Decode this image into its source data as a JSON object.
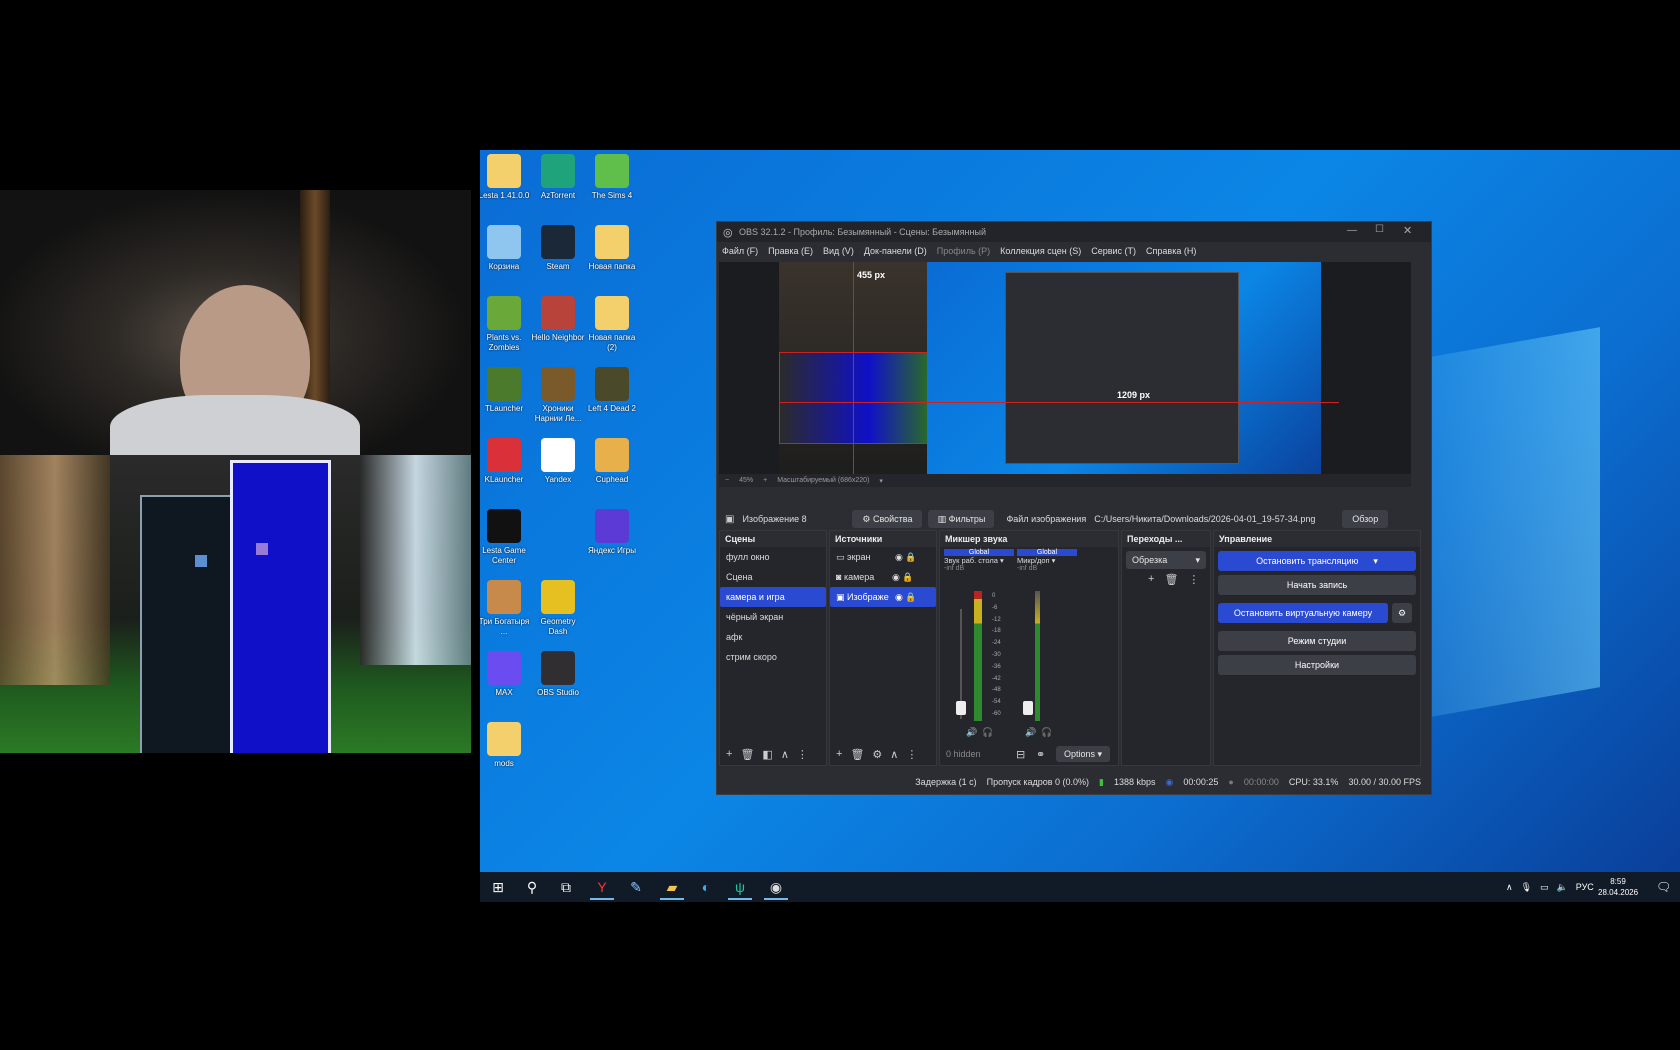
{
  "desktop_icons": [
    {
      "label": "Lesta 1.41.0.0",
      "icon": "folder-icon",
      "color": "#f3d06b"
    },
    {
      "label": "AzTorrent",
      "icon": "torrent-icon",
      "color": "#1fa37a"
    },
    {
      "label": "The Sims 4",
      "icon": "sims-icon",
      "color": "#5fbf4a"
    },
    {
      "label": "Корзина",
      "icon": "recycle-bin-icon",
      "color": "#8fc6ef"
    },
    {
      "label": "Steam",
      "icon": "steam-icon",
      "color": "#1b2838"
    },
    {
      "label": "Новая папка",
      "icon": "folder-icon",
      "color": "#f3d06b"
    },
    {
      "label": "Plants vs. Zombies",
      "icon": "pvz-icon",
      "color": "#6aa83a"
    },
    {
      "label": "Hello Neighbor",
      "icon": "hello-neighbor-icon",
      "color": "#b8433a"
    },
    {
      "label": "Новая папка (2)",
      "icon": "folder-icon",
      "color": "#f3d06b"
    },
    {
      "label": "TLauncher",
      "icon": "tlauncher-icon",
      "color": "#4b7a2c"
    },
    {
      "label": "Хроники Нарнии Ле...",
      "icon": "narnia-icon",
      "color": "#7a5a2a"
    },
    {
      "label": "Left 4 Dead 2",
      "icon": "l4d2-icon",
      "color": "#4a4a2a"
    },
    {
      "label": "KLauncher",
      "icon": "klauncher-icon",
      "color": "#d9303a"
    },
    {
      "label": "Yandex",
      "icon": "yandex-icon",
      "color": "#ffffff"
    },
    {
      "label": "Cuphead",
      "icon": "cuphead-icon",
      "color": "#e7b04a"
    },
    {
      "label": "Lesta Game Center",
      "icon": "lesta-icon",
      "color": "#111111"
    },
    {
      "label": "Яндекс Игры",
      "icon": "yandex-games-icon",
      "color": "#5b3ad6"
    },
    {
      "label": "Три Богатыря ...",
      "icon": "bogatyri-icon",
      "color": "#c88a4a"
    },
    {
      "label": "Geometry Dash",
      "icon": "geometry-dash-icon",
      "color": "#e6c020"
    },
    {
      "label": "MAX",
      "icon": "max-icon",
      "color": "#6a4cf0"
    },
    {
      "label": "OBS Studio",
      "icon": "obs-icon",
      "color": "#302e31"
    },
    {
      "label": "mods",
      "icon": "folder-icon",
      "color": "#f3d06b"
    }
  ],
  "obs": {
    "title": "OBS 32.1.2 - Профиль: Безымянный - Сцены: Безымянный",
    "menu": [
      "Файл (F)",
      "Правка (E)",
      "Вид (V)",
      "Док-панели (D)",
      "Профиль (P)",
      "Коллекция сцен (S)",
      "Сервис (T)",
      "Справка (H)"
    ],
    "preview": {
      "label_top": "455 px",
      "label_right": "1209 px",
      "zoom": "45%",
      "scale_mode": "Масштабируемый (686x220)"
    },
    "source_toolbar": {
      "source_name": "Изображение 8",
      "properties": "Свойства",
      "filters": "Фильтры",
      "file_label": "Файл изображения",
      "file_path": "C:/Users/Никита/Downloads/2026-04-01_19-57-34.png",
      "browse": "Обзор"
    },
    "scenes": {
      "title": "Сцены",
      "items": [
        "фулл окно",
        "Сцена",
        "камера и игра",
        "чёрный экран",
        "афк",
        "стрим скоро"
      ],
      "selected_index": 2
    },
    "sources": {
      "title": "Источники",
      "items": [
        "экран",
        "камера",
        "Изображе"
      ]
    },
    "mixer": {
      "title": "Микшер звука",
      "channels": [
        {
          "badge": "Global",
          "name": "Звук раб. стола",
          "level": "-inf dB"
        },
        {
          "badge": "Global",
          "name": "Микр/доп",
          "level": "-inf dB"
        }
      ],
      "scale": [
        "0",
        "-6",
        "-12",
        "-18",
        "-24",
        "-30",
        "-36",
        "-42",
        "-48",
        "-54",
        "-60"
      ],
      "hidden": "0 hidden",
      "options": "Options"
    },
    "transitions": {
      "title": "Переходы ...",
      "selected": "Обрезка"
    },
    "controls": {
      "title": "Управление",
      "stop_stream": "Остановить трансляцию",
      "start_record": "Начать запись",
      "stop_virtual_cam": "Остановить виртуальную камеру",
      "studio_mode": "Режим студии",
      "settings": "Настройки"
    },
    "status": {
      "delay": "Задержка (1 с)",
      "dropped": "Пропуск кадров 0 (0.0%)",
      "bitrate": "1388 kbps",
      "stream_time": "00:00:25",
      "record_time": "00:00:00",
      "cpu": "CPU: 33.1%",
      "fps": "30.00 / 30.00 FPS"
    }
  },
  "taskbar": {
    "icons": [
      "windows-start-icon",
      "search-icon",
      "task-view-icon",
      "yandex-browser-icon",
      "pen-app-icon",
      "file-explorer-icon",
      "edge-icon",
      "aztorrent-icon",
      "obs-taskbar-icon"
    ],
    "lang": "РУС",
    "time": "8:59",
    "date": "28.04.2026"
  }
}
